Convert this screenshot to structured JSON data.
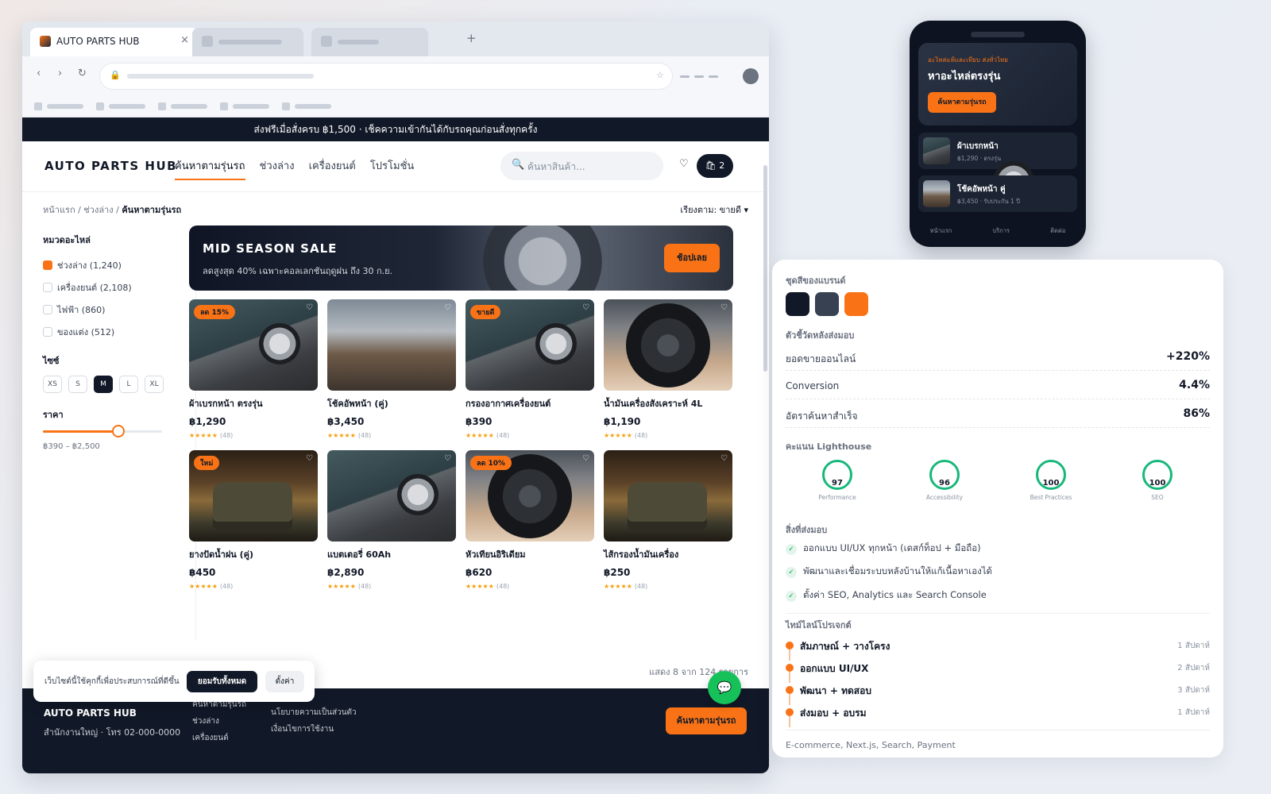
{
  "browser": {
    "tab_title": "AUTO PARTS HUB",
    "tab_close": "×",
    "new_tab": "+"
  },
  "promo_bar": "ส่งฟรีเมื่อสั่งครบ ฿1,500 · เช็คความเข้ากันได้กับรถคุณก่อนสั่งทุกครั้ง",
  "header": {
    "brand": "AUTO PARTS HUB",
    "nav": [
      "ค้นหาตามรุ่นรถ",
      "ช่วงล่าง",
      "เครื่องยนต์",
      "โปรโมชั่น"
    ],
    "search_placeholder": "ค้นหาสินค้า...",
    "cart_count": "2"
  },
  "breadcrumb": {
    "path": "หน้าแรก / ช่วงล่าง / ",
    "current": "ค้นหาตามรุ่นรถ"
  },
  "sort_label": "เรียงตาม: ขายดี",
  "sidebar": {
    "categories_title": "หมวดอะไหล่",
    "categories": [
      {
        "label": "ช่วงล่าง (1,240)",
        "checked": true
      },
      {
        "label": "เครื่องยนต์ (2,108)",
        "checked": false
      },
      {
        "label": "ไฟฟ้า (860)",
        "checked": false
      },
      {
        "label": "ของแต่ง (512)",
        "checked": false
      }
    ],
    "size_title": "ไซซ์",
    "sizes": [
      "XS",
      "S",
      "M",
      "L",
      "XL"
    ],
    "selected_size": "M",
    "price_title": "ราคา",
    "price_range_text": "฿390 – ฿2,500",
    "price_slider_fraction": 0.63
  },
  "banner": {
    "title": "MID SEASON SALE",
    "subtitle": "ลดสูงสุด 40% เฉพาะคอลเลกชันฤดูฝน ถึง 30 ก.ย.",
    "cta": "ช้อปเลย"
  },
  "products": [
    {
      "name": "ผ้าเบรกหน้า ตรงรุ่น",
      "price": "฿1,290",
      "stars": "★★★★★",
      "reviews": "(48)",
      "badge": "ลด 15%",
      "image": "car"
    },
    {
      "name": "โช้คอัพหน้า (คู่)",
      "price": "฿3,450",
      "stars": "★★★★★",
      "reviews": "(48)",
      "badge": "",
      "image": "garage"
    },
    {
      "name": "กรองอากาศเครื่องยนต์",
      "price": "฿390",
      "stars": "★★★★★",
      "reviews": "(48)",
      "badge": "ขายดี",
      "image": "car"
    },
    {
      "name": "น้ำมันเครื่องสังเคราะห์ 4L",
      "price": "฿1,190",
      "stars": "★★★★★",
      "reviews": "(48)",
      "badge": "",
      "image": "tire"
    },
    {
      "name": "ยางปัดน้ำฝน (คู่)",
      "price": "฿450",
      "stars": "★★★★★",
      "reviews": "(48)",
      "badge": "ใหม่",
      "image": "vintage"
    },
    {
      "name": "แบตเตอรี่ 60Ah",
      "price": "฿2,890",
      "stars": "★★★★★",
      "reviews": "(48)",
      "badge": "",
      "image": "car"
    },
    {
      "name": "หัวเทียนอิริเดียม",
      "price": "฿620",
      "stars": "★★★★★",
      "reviews": "(48)",
      "badge": "ลด 10%",
      "image": "tire"
    },
    {
      "name": "ไส้กรองน้ำมันเครื่อง",
      "price": "฿250",
      "stars": "★★★★★",
      "reviews": "(48)",
      "badge": "",
      "image": "vintage"
    }
  ],
  "results_text": "แสดง 8 จาก 124 รายการ",
  "footer": {
    "brand": "AUTO PARTS HUB",
    "address": "สำนักงานใหญ่ · โทร 02-000-0000",
    "col1": [
      "ค้นหาตามรุ่นรถ",
      "ช่วงล่าง",
      "เครื่องยนต์"
    ],
    "col2": [
      "นโยบายความเป็นส่วนตัว",
      "เงื่อนไขการใช้งาน"
    ],
    "cta": "ค้นหาตามรุ่นรถ"
  },
  "cookie": {
    "message": "เว็บไซต์นี้ใช้คุกกี้เพื่อประสบการณ์ที่ดีขึ้น",
    "accept": "ยอมรับทั้งหมด",
    "settings": "ตั้งค่า"
  },
  "phone": {
    "kicker": "อะไหล่แท้และเทียบ ส่งทั่วไทย",
    "title": "หาอะไหล่ตรงรุ่น",
    "cta": "ค้นหาตามรุ่นรถ",
    "items": [
      {
        "name": "ผ้าเบรกหน้า",
        "meta": "฿1,290 · ตรงรุ่น"
      },
      {
        "name": "โช้คอัพหน้า คู่",
        "meta": "฿3,450 · รับประกัน 1 ปี"
      }
    ],
    "nav": [
      "หน้าแรก",
      "บริการ",
      "ติดต่อ"
    ]
  },
  "case_study": {
    "palette_title": "ชุดสีของแบรนด์",
    "palette": [
      "#111827",
      "#374151",
      "#f97316"
    ],
    "kpi_title": "ตัวชี้วัดหลังส่งมอบ",
    "kpis": [
      {
        "label": "ยอดขายออนไลน์",
        "value": "+220%"
      },
      {
        "label": "Conversion",
        "value": "4.4%"
      },
      {
        "label": "อัตราค้นหาสำเร็จ",
        "value": "86%"
      }
    ],
    "lighthouse_title": "คะแนน Lighthouse",
    "lighthouse": [
      {
        "label": "Performance",
        "score": "97"
      },
      {
        "label": "Accessibility",
        "score": "96"
      },
      {
        "label": "Best Practices",
        "score": "100"
      },
      {
        "label": "SEO",
        "score": "100"
      }
    ],
    "deliverables_title": "สิ่งที่ส่งมอบ",
    "deliverables": [
      "ออกแบบ UI/UX ทุกหน้า (เดสก์ท็อป + มือถือ)",
      "พัฒนาและเชื่อมระบบหลังบ้านให้แก้เนื้อหาเองได้",
      "ตั้งค่า SEO, Analytics และ Search Console"
    ],
    "timeline_title": "ไทม์ไลน์โปรเจกต์",
    "timeline": [
      {
        "step": "สัมภาษณ์ + วางโครง",
        "duration": "1 สัปดาห์"
      },
      {
        "step": "ออกแบบ UI/UX",
        "duration": "2 สัปดาห์"
      },
      {
        "step": "พัฒนา + ทดสอบ",
        "duration": "3 สัปดาห์"
      },
      {
        "step": "ส่งมอบ + อบรม",
        "duration": "1 สัปดาห์"
      }
    ],
    "tags": "E-commerce, Next.js, Search, Payment"
  },
  "colors": {
    "accent": "#f97316",
    "dark": "#111827",
    "success": "#16b87a"
  }
}
